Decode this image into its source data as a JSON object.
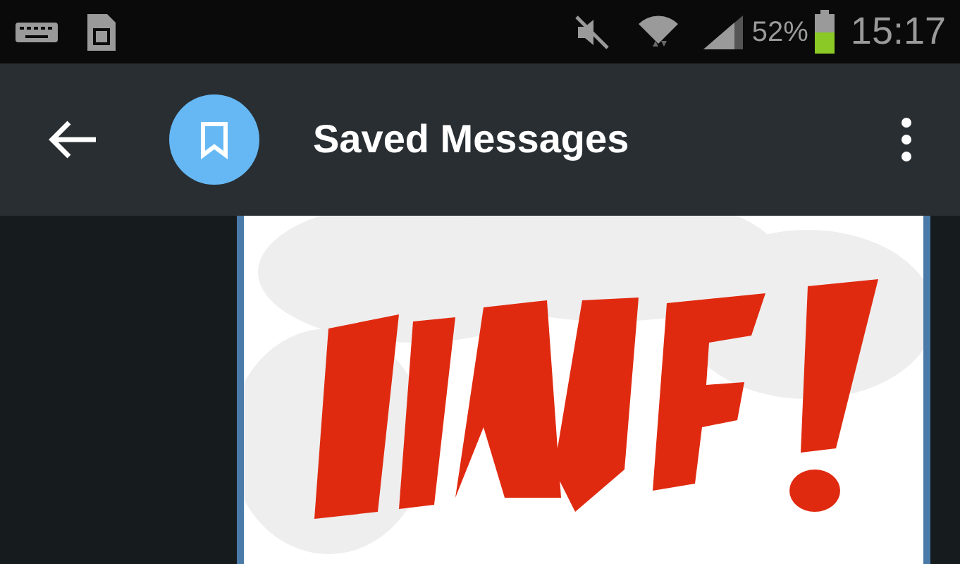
{
  "status_bar": {
    "battery_text": "52%",
    "time": "15:17"
  },
  "app_bar": {
    "title": "Saved Messages"
  }
}
